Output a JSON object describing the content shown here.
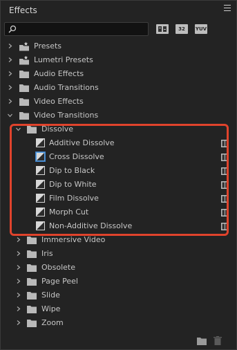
{
  "panel": {
    "title": "Effects"
  },
  "search": {
    "value": "",
    "placeholder": ""
  },
  "filters": [
    {
      "label": ""
    },
    {
      "label": "32"
    },
    {
      "label": "YUV"
    }
  ],
  "tree": {
    "presets": "Presets",
    "lumetri_presets": "Lumetri Presets",
    "audio_effects": "Audio Effects",
    "audio_transitions": "Audio Transitions",
    "video_effects": "Video Effects",
    "video_transitions": "Video Transitions",
    "dissolve": "Dissolve",
    "dissolve_items": [
      "Additive Dissolve",
      "Cross Dissolve",
      "Dip to Black",
      "Dip to White",
      "Film Dissolve",
      "Morph Cut",
      "Non-Additive Dissolve"
    ],
    "subfolders": [
      "Immersive Video",
      "Iris",
      "Obsolete",
      "Page Peel",
      "Slide",
      "Wipe",
      "Zoom"
    ]
  },
  "colors": {
    "accent_highlight": "#e0432c",
    "background": "#232323"
  }
}
